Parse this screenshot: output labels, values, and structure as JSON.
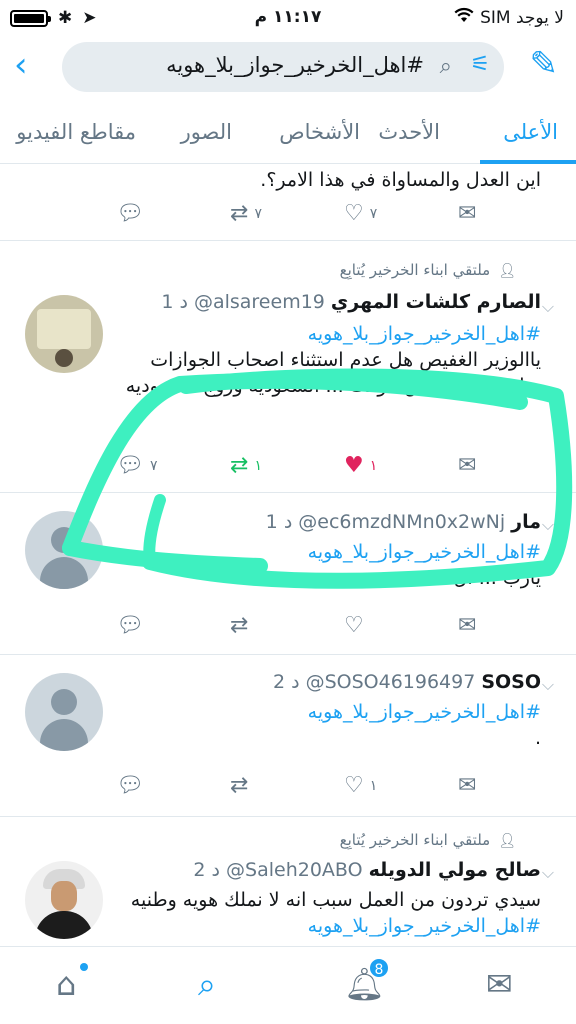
{
  "statusbar": {
    "carrier": "لا يوجد SIM",
    "time": "١١:١٧ م"
  },
  "search": {
    "query": "#اهل_الخرخير_جواز_بلا_هويه"
  },
  "tabs": [
    {
      "label": "الأعلى",
      "active": true
    },
    {
      "label": "الأحدث"
    },
    {
      "label": "الأشخاص"
    },
    {
      "label": "الصور"
    },
    {
      "label": "مقاطع الفيديو"
    }
  ],
  "tweets": [
    {
      "text": "اين العدل والمساواة في هذا الامر؟.",
      "retweets": "٧",
      "likes": "٧",
      "replies": ""
    },
    {
      "social": "ملتقي ابناء الخرخير يُتابِع",
      "name": "الصارم كلشات المهري",
      "handle": "@alsareem19",
      "time": "1 د",
      "hashtag": "#اهل_الخرخير_جواز_بلا_هويه",
      "text": "ياالوزير الغفيص هل عدم استثناء اصحاب الجوازات سابقا... في نفس الوقت ... السعوديه وزوج السعوديه",
      "replies": "٧",
      "retweets": "١",
      "likes": "١"
    },
    {
      "name": "مار",
      "handle": "@ec6mzdNMn0x2wNj",
      "time": "1 د",
      "hashtag": "#اهل_الخرخير_جواز_بلا_هويه",
      "text": "يارب ... ال...",
      "replies": "",
      "retweets": "",
      "likes": ""
    },
    {
      "name": "SOSO",
      "handle": "@SOSO46196497",
      "time": "2 د",
      "hashtag": "#اهل_الخرخير_جواز_بلا_هويه",
      "text": ".",
      "replies": "",
      "retweets": "",
      "likes": "١"
    },
    {
      "social": "ملتقي ابناء الخرخير يُتابِع",
      "name": "صالح مولي الدويله",
      "handle": "@Saleh20ABO",
      "time": "2 د",
      "text": "سيدي تردون من العمل سبب انه لا نملك هويه وطنيه",
      "hashtag": "#اهل_الخرخير_جواز_بلا_هويه"
    }
  ],
  "nav": {
    "notifications_badge": "8"
  },
  "colors": {
    "accent": "#1da1f2",
    "retweet": "#17bf63",
    "like": "#e0245e",
    "annotation": "#3ef0c0"
  }
}
